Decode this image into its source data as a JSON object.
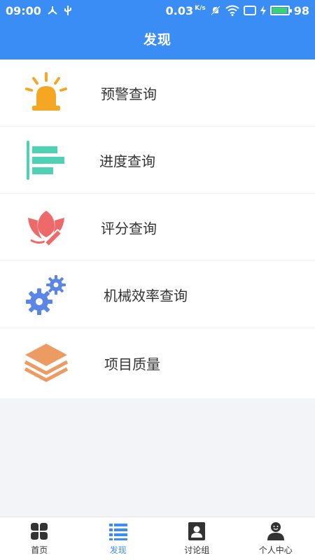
{
  "status_bar": {
    "time": "09:00",
    "network_speed": "0.03",
    "network_unit": "K/s",
    "battery_level": "98"
  },
  "header": {
    "title": "发现"
  },
  "menu": {
    "items": [
      {
        "label": "预警查询",
        "icon": "alarm-light-icon",
        "color": "#f5a623"
      },
      {
        "label": "进度查询",
        "icon": "progress-bars-icon",
        "color": "#4fd1b5"
      },
      {
        "label": "评分查询",
        "icon": "lotus-pencil-icon",
        "color": "#ee6a6a"
      },
      {
        "label": "机械效率查询",
        "icon": "gears-icon",
        "color": "#5b86e5"
      },
      {
        "label": "项目质量",
        "icon": "layers-icon",
        "color": "#ec9b63"
      }
    ]
  },
  "tabbar": {
    "tabs": [
      {
        "label": "首页",
        "icon": "grid-petals-icon",
        "active": false
      },
      {
        "label": "发现",
        "icon": "list-icon",
        "active": true
      },
      {
        "label": "讨论组",
        "icon": "contact-card-icon",
        "active": false
      },
      {
        "label": "个人中心",
        "icon": "user-icon",
        "active": false
      }
    ]
  },
  "colors": {
    "accent": "#3a8df5",
    "background": "#f2f4f8"
  }
}
